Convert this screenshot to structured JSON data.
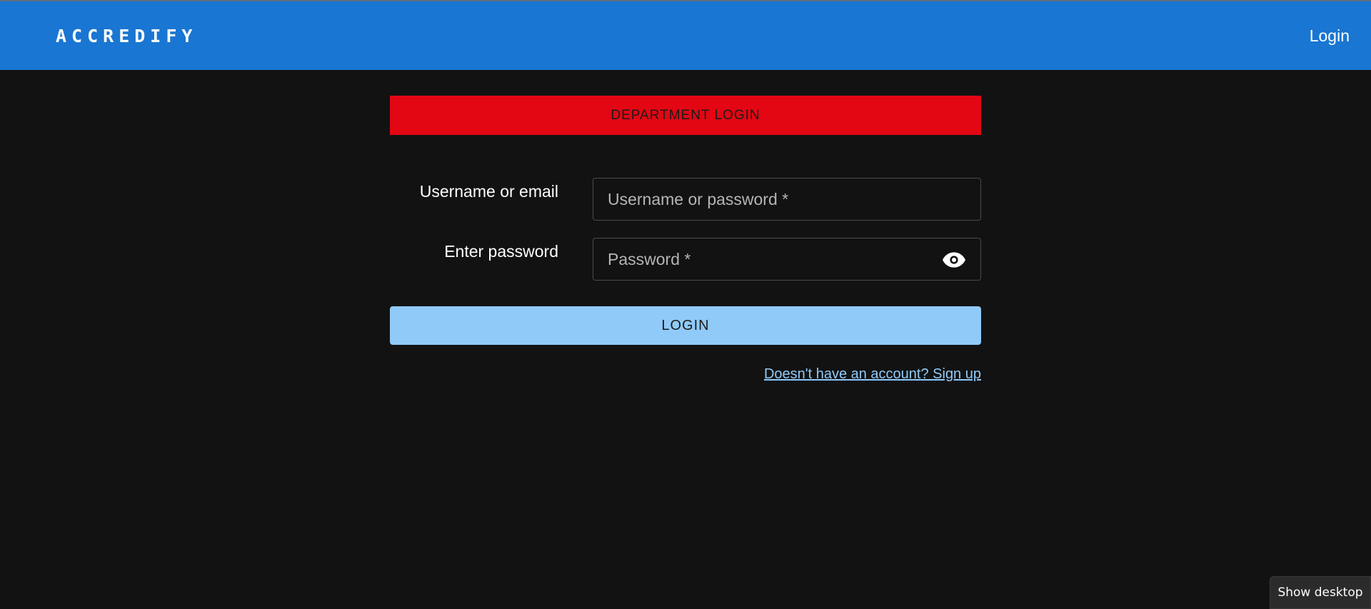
{
  "header": {
    "brand": "ACCREDIFY",
    "login_label": "Login"
  },
  "banner": {
    "title": "DEPARTMENT LOGIN",
    "color": "#e30613"
  },
  "form": {
    "username_label": "Username or email",
    "username_placeholder": "Username or password *",
    "username_value": "",
    "password_label": "Enter password",
    "password_placeholder": "Password *",
    "password_value": "",
    "password_toggle_icon": "eye-icon",
    "submit_label": "LOGIN"
  },
  "signup": {
    "link_text": "Doesn't have an account? Sign up"
  },
  "taskbar": {
    "show_desktop_tooltip": "Show desktop"
  },
  "colors": {
    "header_bg": "#1976d2",
    "page_bg": "#121212",
    "button_bg": "#90caf9",
    "link": "#90caf9"
  }
}
